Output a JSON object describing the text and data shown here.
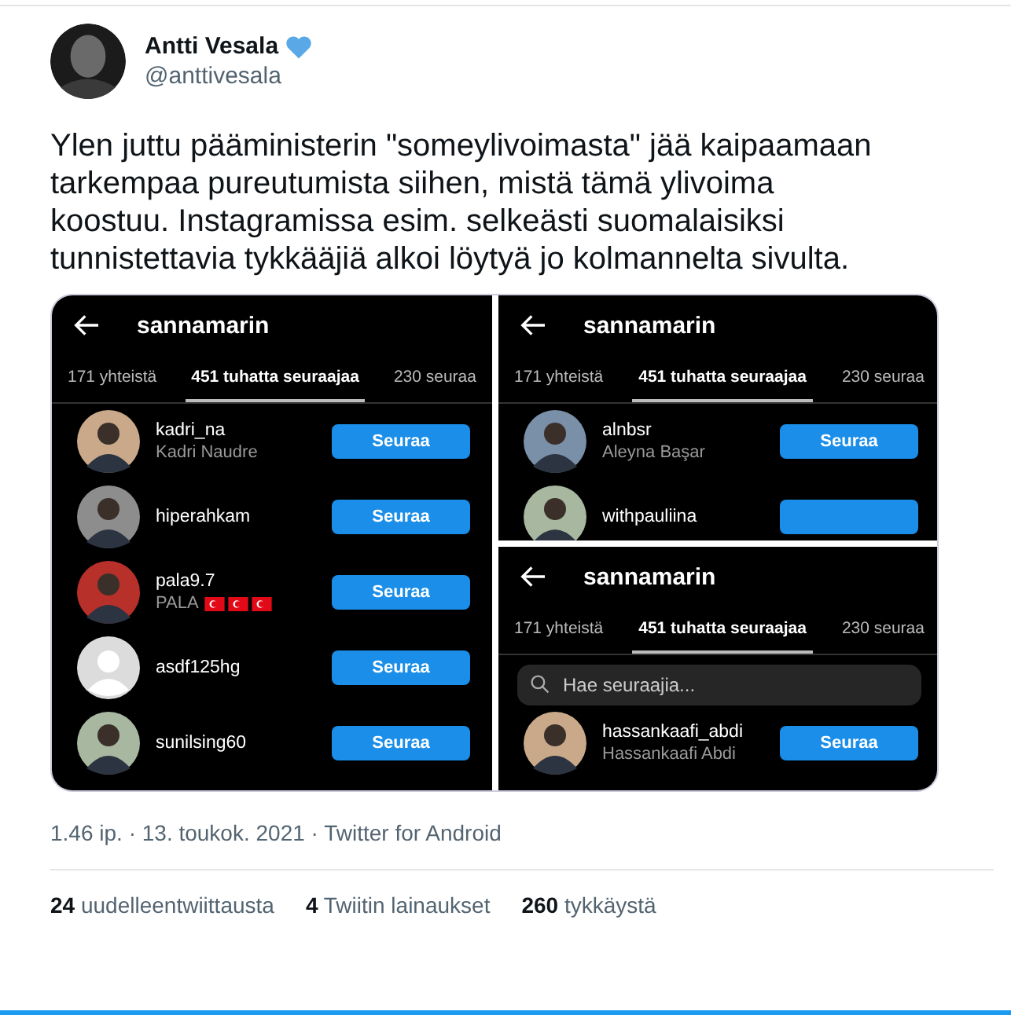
{
  "author": {
    "name": "Antti Vesala",
    "handle": "@anttivesala",
    "verified_heart": true
  },
  "text": "Ylen juttu pääministerin \"someylivoimasta\" jää kaipaamaan  tarkempaa pureutumista siihen, mistä tämä ylivoima koostuu. Instagramissa esim. selkeästi suomalaisiksi tunnistettavia tykkääjiä alkoi löytyä jo kolmannelta sivulta.",
  "panels": [
    {
      "title": "sannamarin",
      "tabs": [
        {
          "label": "171 yhteistä",
          "selected": false
        },
        {
          "label": "451 tuhatta seuraajaa",
          "selected": true
        },
        {
          "label": "230 seuraa",
          "selected": false
        }
      ],
      "rows": [
        {
          "username": "kadri_na",
          "full_name": "Kadri Naudre",
          "kind": "plain",
          "button": "Seuraa"
        },
        {
          "username": "hiperahkam",
          "kind": "plain",
          "button": "Seuraa"
        },
        {
          "username": "pala9.7",
          "full_name": "PALA",
          "kind": "flags",
          "button": "Seuraa"
        },
        {
          "username": "asdf125hg",
          "kind": "plain",
          "avatar": {
            "kind": "default"
          },
          "button": "Seuraa"
        },
        {
          "username": "sunilsing60",
          "kind": "plain",
          "button": "Seuraa"
        }
      ]
    },
    {
      "title": "sannamarin",
      "tabs": [
        {
          "label": "171 yhteistä",
          "selected": false
        },
        {
          "label": "451 tuhatta seuraajaa",
          "selected": true
        },
        {
          "label": "230 seuraa",
          "selected": false
        }
      ],
      "rows": [
        {
          "username": "alnbsr",
          "full_name": "Aleyna Başar",
          "kind": "plain",
          "button": "Seuraa"
        },
        {
          "username": "withpauliina",
          "kind": "plain"
        }
      ]
    },
    {
      "title": "sannamarin",
      "tabs": [
        {
          "label": "171 yhteistä",
          "selected": false
        },
        {
          "label": "451 tuhatta seuraajaa",
          "selected": true
        },
        {
          "label": "230 seuraa",
          "selected": false
        }
      ],
      "search": {
        "placeholder": "Hae seuraajia..."
      },
      "rows": [
        {
          "username": "hassankaafi_abdi",
          "full_name": "Hassankaafi Abdi",
          "kind": "plain",
          "button": "Seuraa"
        }
      ]
    }
  ],
  "meta": "1.46 ip. · 13. toukok. 2021 · Twitter for Android",
  "stats": [
    {
      "count": "24",
      "label": "uudelleentwiittausta"
    },
    {
      "count": "4",
      "label": "Twiitin lainaukset"
    },
    {
      "count": "260",
      "label": "tykkäystä"
    }
  ]
}
